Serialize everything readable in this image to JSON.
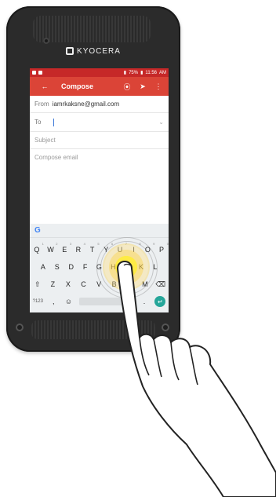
{
  "device": {
    "brand": "KYOCERA"
  },
  "statusbar": {
    "left_icons": [
      "notification-icon",
      "sync-icon"
    ],
    "battery": "75%",
    "time": "11:56",
    "ampm": "AM"
  },
  "appbar": {
    "title": "Compose",
    "back_icon": "arrow-back-icon",
    "attach_icon": "attach-icon",
    "send_icon": "send-icon",
    "more_icon": "more-vert-icon"
  },
  "compose": {
    "from_label": "From",
    "from_value": "iamrkaksne@gmail.com",
    "to_label": "To",
    "subject_placeholder": "Subject",
    "body_placeholder": "Compose email"
  },
  "keyboard": {
    "row1": [
      "Q",
      "W",
      "E",
      "R",
      "T",
      "Y",
      "U",
      "I",
      "O",
      "P"
    ],
    "row1_hints": [
      "1",
      "2",
      "3",
      "4",
      "5",
      "6",
      "7",
      "8",
      "9",
      "0"
    ],
    "row2": [
      "A",
      "S",
      "D",
      "F",
      "G",
      "H",
      "J",
      "K",
      "L"
    ],
    "row3": [
      "Z",
      "X",
      "C",
      "V",
      "B",
      "N",
      "M"
    ],
    "symbols_label": "?123",
    "comma": ",",
    "emoji_icon": "emoji-icon",
    "period": "."
  }
}
